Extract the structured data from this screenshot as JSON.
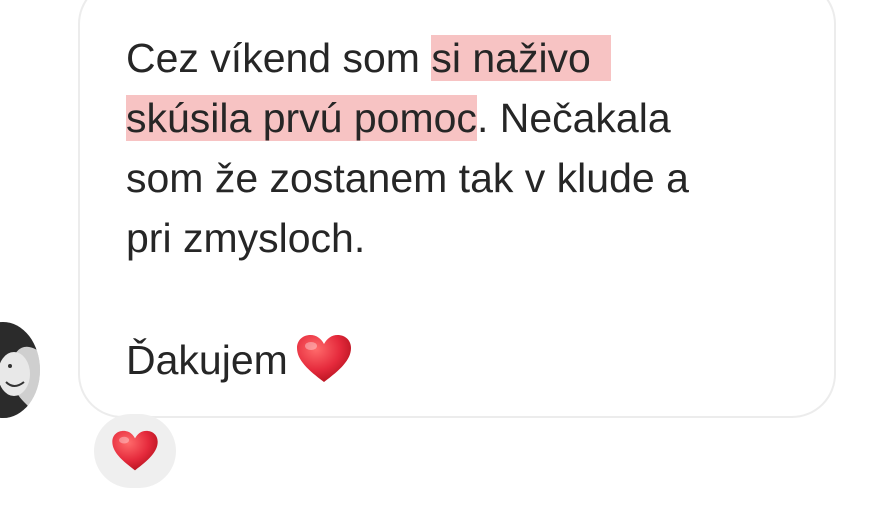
{
  "message": {
    "line1_plain": "Cez víkend som ",
    "line1_highlight": "si naživo",
    "line2_highlight": "skúsila prvú pomoc",
    "line2_plain": ". Nečakala",
    "line3": "som že zostanem tak v klude a",
    "line4": "pri zmysloch.",
    "line5": "Ďakujem"
  },
  "colors": {
    "highlight": "#f7c3c3",
    "heart": "#e52a3c",
    "bubble_border": "#ececec",
    "reaction_bg": "#efefef"
  },
  "icons": {
    "inline_heart": "heart-icon",
    "reaction": "heart-reaction-icon",
    "avatar": "user-avatar"
  }
}
